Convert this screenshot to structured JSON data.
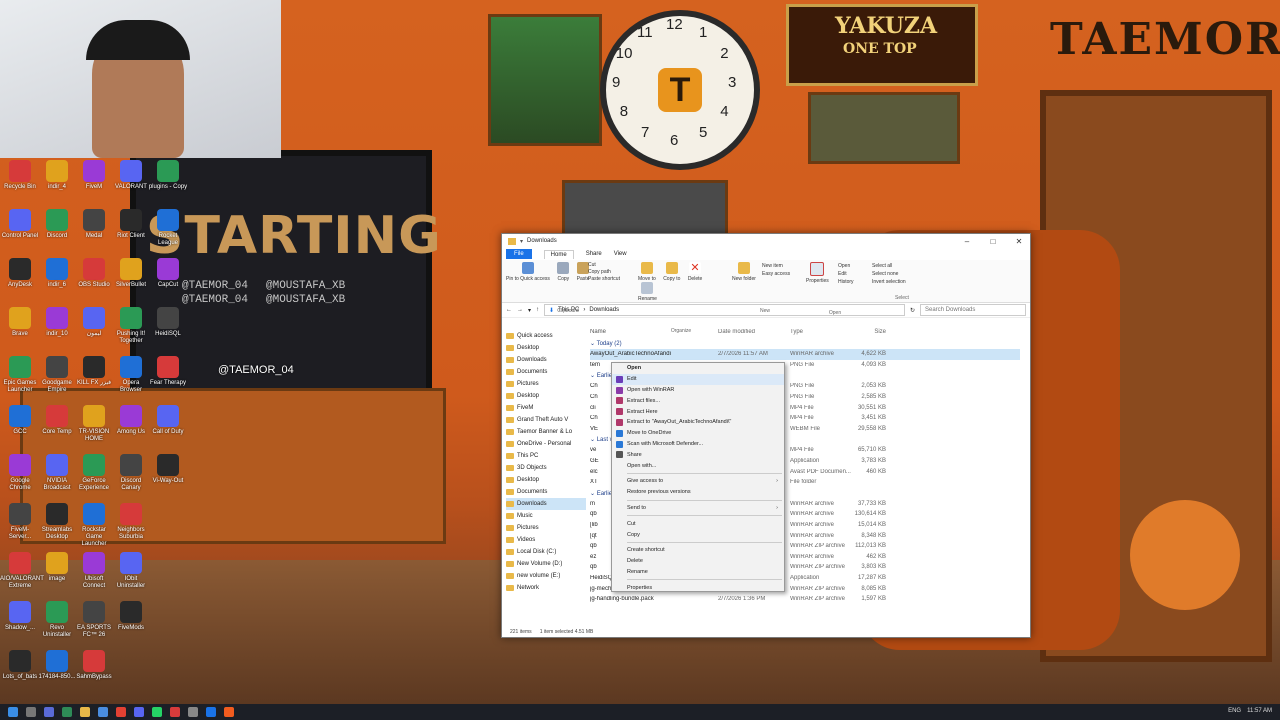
{
  "desktop": {
    "icons_col1": [
      "Recycle Bin",
      "Control Panel",
      "AnyDesk",
      "Brave",
      "Epic Games Launcher",
      "GCC",
      "Google Chrome",
      "FiveM-Server...",
      "AIO/VALORANT Extreme",
      "Shadow_...",
      "Lots_of_bats"
    ],
    "icons_col2": [
      "indir_4",
      "Discord",
      "indir_6",
      "indir_10",
      "Goodgame Empire",
      "Core Temp",
      "NVIDIA Broadcast",
      "Streamlabs Desktop",
      "image",
      "Revo Uninstaller",
      "174184-850..."
    ],
    "icons_col3": [
      "FiveM",
      "Medal",
      "OBS Studio",
      "ليمون",
      "KILL FX فيزر",
      "TR-VISION HOME",
      "GeForce Experience",
      "Rockstar Game Launcher",
      "Ubisoft Connect",
      "EA SPORTS FC™ 26",
      "SahmBypass"
    ],
    "icons_col4": [
      "VALORANT",
      "Riot Client",
      "SilverBullet",
      "Pushing It! Together",
      "Opera Browser",
      "Among Us",
      "Discord Canary",
      "Neighbors Suburbia",
      "IObit Uninstaller",
      "FiveMods"
    ],
    "icons_col5": [
      "plugins - Copy",
      "Rocket League",
      "CapCut",
      "HeidiSQL",
      "Fear Therapy",
      "Call of Duty",
      "Vi-Way-Out"
    ]
  },
  "scene": {
    "sign_yakuza": "YAKUZA",
    "sign_onetop": "ONE TOP",
    "sign_taemor": "TAEMOR",
    "clock_center": "T",
    "clock_numbers": [
      "12",
      "1",
      "2",
      "3",
      "4",
      "5",
      "6",
      "7",
      "8",
      "9",
      "10",
      "11"
    ],
    "tv_text": "STARTING",
    "tv_handles": [
      "@TAEMOR_04",
      "@MOUSTAFA_XB",
      "@TAEMOR_04",
      "@MOUSTAFA_XB"
    ],
    "overlay_handle": "@TAEMOR_04"
  },
  "explorer": {
    "title": "Downloads",
    "tabs": [
      "File",
      "Home",
      "Share",
      "View"
    ],
    "ribbon": {
      "clipboard": {
        "label": "Clipboard",
        "items": [
          "Pin to Quick access",
          "Copy",
          "Paste",
          "Cut",
          "Copy path",
          "Paste shortcut"
        ]
      },
      "organize": {
        "label": "Organize",
        "items": [
          "Move to",
          "Copy to",
          "Delete",
          "Rename"
        ]
      },
      "new": {
        "label": "New",
        "items": [
          "New folder",
          "New item",
          "Easy access"
        ]
      },
      "open": {
        "label": "Open",
        "items": [
          "Properties",
          "Open",
          "Edit",
          "History"
        ]
      },
      "select": {
        "label": "Select",
        "items": [
          "Select all",
          "Select none",
          "Invert selection"
        ]
      }
    },
    "address": {
      "path": [
        "This PC",
        "Downloads"
      ],
      "search_placeholder": "Search Downloads"
    },
    "columns": {
      "name": "Name",
      "date": "Date modified",
      "type": "Type",
      "size": "Size"
    },
    "nav": [
      {
        "label": "Quick access",
        "sel": false
      },
      {
        "label": "Desktop",
        "sel": false
      },
      {
        "label": "Downloads",
        "sel": false
      },
      {
        "label": "Documents",
        "sel": false
      },
      {
        "label": "Pictures",
        "sel": false
      },
      {
        "label": "Desktop",
        "sel": false
      },
      {
        "label": "FiveM",
        "sel": false
      },
      {
        "label": "Grand Theft Auto V",
        "sel": false
      },
      {
        "label": "Taemor Banner & Lo",
        "sel": false
      },
      {
        "label": "OneDrive - Personal",
        "sel": false
      },
      {
        "label": "This PC",
        "sel": false
      },
      {
        "label": "3D Objects",
        "sel": false
      },
      {
        "label": "Desktop",
        "sel": false
      },
      {
        "label": "Documents",
        "sel": false
      },
      {
        "label": "Downloads",
        "sel": true
      },
      {
        "label": "Music",
        "sel": false
      },
      {
        "label": "Pictures",
        "sel": false
      },
      {
        "label": "Videos",
        "sel": false
      },
      {
        "label": "Local Disk (C:)",
        "sel": false
      },
      {
        "label": "New Volume (D:)",
        "sel": false
      },
      {
        "label": "new volume (E:)",
        "sel": false
      },
      {
        "label": "Network",
        "sel": false
      }
    ],
    "groups": [
      {
        "title": "Today (2)",
        "rows": [
          {
            "name": "AwayOut_ArabicTechnoAfandi",
            "date": "2/7/2026 11:57 AM",
            "type": "WinRAR archive",
            "size": "4,622 KB",
            "sel": true
          },
          {
            "name": "tem",
            "date": "",
            "type": "PNG File",
            "size": "4,093 KB",
            "sel": false
          }
        ]
      },
      {
        "title": "Earlier this week",
        "rows": [
          {
            "name": "Ch",
            "date": "",
            "type": "PNG File",
            "size": "2,053 KB",
            "sel": false
          },
          {
            "name": "Ch",
            "date": "",
            "type": "PNG File",
            "size": "2,585 KB",
            "sel": false
          },
          {
            "name": "cli",
            "date": "",
            "type": "MP4 File",
            "size": "30,551 KB",
            "sel": false
          },
          {
            "name": "Ch",
            "date": "",
            "type": "MP4 File",
            "size": "3,451 KB",
            "sel": false
          },
          {
            "name": "VE",
            "date": "",
            "type": "WEBM File",
            "size": "29,558 KB",
            "sel": false
          }
        ]
      },
      {
        "title": "Last week",
        "rows": [
          {
            "name": "ve",
            "date": "",
            "type": "MP4 File",
            "size": "65,710 KB",
            "sel": false
          },
          {
            "name": "GE",
            "date": "",
            "type": "Application",
            "size": "3,783 KB",
            "sel": false
          },
          {
            "name": "elc",
            "date": "",
            "type": "Avast PDF Documen...",
            "size": "460 KB",
            "sel": false
          },
          {
            "name": "XT",
            "date": "",
            "type": "File folder",
            "size": "",
            "sel": false
          }
        ]
      },
      {
        "title": "Earlier this month",
        "rows": [
          {
            "name": "m",
            "date": "",
            "type": "WinRAR archive",
            "size": "37,733 KB",
            "sel": false
          },
          {
            "name": "qb",
            "date": "",
            "type": "WinRAR archive",
            "size": "130,614 KB",
            "sel": false
          },
          {
            "name": "[lib",
            "date": "",
            "type": "WinRAR archive",
            "size": "15,014 KB",
            "sel": false
          },
          {
            "name": "[qt",
            "date": "",
            "type": "WinRAR archive",
            "size": "8,348 KB",
            "sel": false
          },
          {
            "name": "qb",
            "date": "",
            "type": "WinRAR ZIP archive",
            "size": "112,013 KB",
            "sel": false
          },
          {
            "name": "ez",
            "date": "",
            "type": "WinRAR archive",
            "size": "462 KB",
            "sel": false
          },
          {
            "name": "qb",
            "date": "",
            "type": "WinRAR ZIP archive",
            "size": "3,803 KB",
            "sel": false
          },
          {
            "name": "HeidiSQL_12.15.0.7171_Setup",
            "date": "2/7/2026 1:36 PM",
            "type": "Application",
            "size": "17,287 KB",
            "sel": false
          },
          {
            "name": "jg-mechanic-bundle.pack",
            "date": "2/7/2026 1:36 PM",
            "type": "WinRAR ZIP archive",
            "size": "8,085 KB",
            "sel": false
          },
          {
            "name": "jg-handling-bundle.pack",
            "date": "2/7/2026 1:36 PM",
            "type": "WinRAR ZIP archive",
            "size": "1,597 KB",
            "sel": false
          }
        ]
      }
    ],
    "status": {
      "count": "221 items",
      "selected": "1 item selected  4.51 MB"
    }
  },
  "context_menu": [
    {
      "label": "Open",
      "bold": true,
      "icon": "",
      "arrow": false,
      "hl": false
    },
    {
      "label": "Edit",
      "bold": false,
      "icon": "#6a3db8",
      "arrow": false,
      "hl": true
    },
    {
      "label": "Open with WinRAR",
      "bold": false,
      "icon": "#8a3aa8",
      "arrow": false,
      "hl": false
    },
    {
      "label": "Extract files...",
      "bold": false,
      "icon": "#b0386a",
      "arrow": false,
      "hl": false
    },
    {
      "label": "Extract Here",
      "bold": false,
      "icon": "#b0386a",
      "arrow": false,
      "hl": false
    },
    {
      "label": "Extract to \"AwayOut_ArabicTechnoAfandi\\\"",
      "bold": false,
      "icon": "#b0386a",
      "arrow": false,
      "hl": false
    },
    {
      "label": "Move to OneDrive",
      "bold": false,
      "icon": "#2a78d6",
      "arrow": false,
      "hl": false
    },
    {
      "label": "Scan with Microsoft Defender...",
      "bold": false,
      "icon": "#2a78d6",
      "arrow": false,
      "hl": false
    },
    {
      "label": "Share",
      "bold": false,
      "icon": "#555",
      "arrow": false,
      "hl": false
    },
    {
      "label": "Open with...",
      "bold": false,
      "icon": "",
      "arrow": false,
      "hl": false
    },
    {
      "sep": true
    },
    {
      "label": "Give access to",
      "bold": false,
      "icon": "",
      "arrow": true,
      "hl": false
    },
    {
      "label": "Restore previous versions",
      "bold": false,
      "icon": "",
      "arrow": false,
      "hl": false
    },
    {
      "sep": true
    },
    {
      "label": "Send to",
      "bold": false,
      "icon": "",
      "arrow": true,
      "hl": false
    },
    {
      "sep": true
    },
    {
      "label": "Cut",
      "bold": false,
      "icon": "",
      "arrow": false,
      "hl": false
    },
    {
      "label": "Copy",
      "bold": false,
      "icon": "",
      "arrow": false,
      "hl": false
    },
    {
      "sep": true
    },
    {
      "label": "Create shortcut",
      "bold": false,
      "icon": "",
      "arrow": false,
      "hl": false
    },
    {
      "label": "Delete",
      "bold": false,
      "icon": "",
      "arrow": false,
      "hl": false
    },
    {
      "label": "Rename",
      "bold": false,
      "icon": "",
      "arrow": false,
      "hl": false
    },
    {
      "sep": true
    },
    {
      "label": "Properties",
      "bold": false,
      "icon": "",
      "arrow": false,
      "hl": false
    }
  ],
  "taskbar": {
    "lang": "ENG",
    "time": "11:57 AM"
  },
  "colors": {
    "accent": "#1a73e8",
    "selection": "#cce4f7",
    "wall": "#d5621f"
  }
}
